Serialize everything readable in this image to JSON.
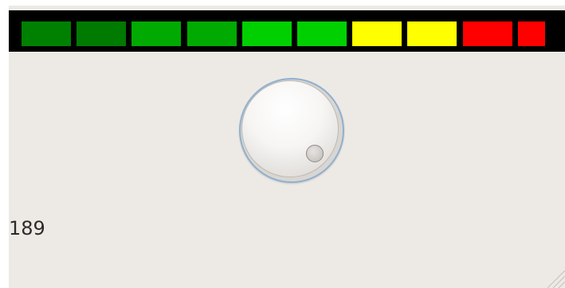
{
  "meter": {
    "level": 0.96,
    "segments": [
      {
        "color": "#008000"
      },
      {
        "color": "#007a00"
      },
      {
        "color": "#00aa00"
      },
      {
        "color": "#00aa00"
      },
      {
        "color": "#00d000"
      },
      {
        "color": "#00d000"
      },
      {
        "color": "#ffff00"
      },
      {
        "color": "#ffff00"
      },
      {
        "color": "#ff0000"
      },
      {
        "color": "#ff0000"
      }
    ]
  },
  "dial": {
    "icon": "dial-knob-icon"
  },
  "value": {
    "text": "189"
  }
}
